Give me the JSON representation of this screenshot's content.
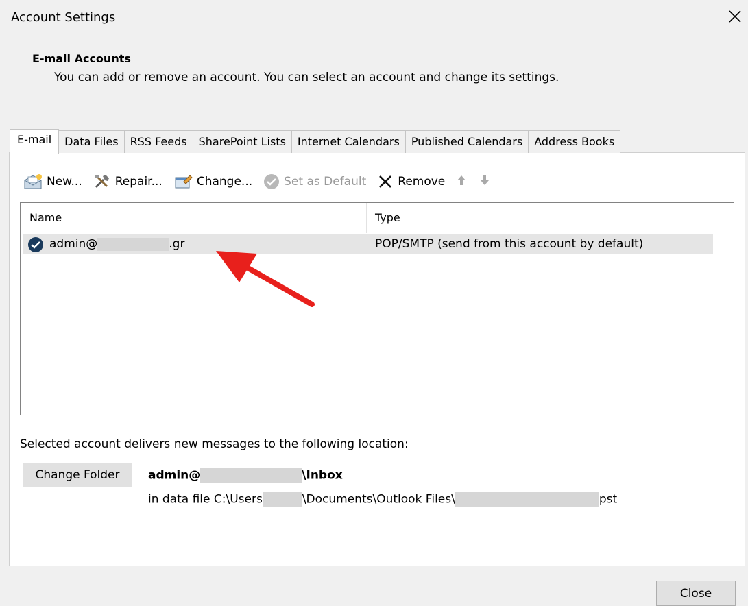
{
  "window": {
    "title": "Account Settings"
  },
  "section": {
    "title": "E-mail Accounts",
    "description": "You can add or remove an account. You can select an account and change its settings."
  },
  "tabs": [
    {
      "label": "E-mail",
      "active": true
    },
    {
      "label": "Data Files",
      "active": false
    },
    {
      "label": "RSS Feeds",
      "active": false
    },
    {
      "label": "SharePoint Lists",
      "active": false
    },
    {
      "label": "Internet Calendars",
      "active": false
    },
    {
      "label": "Published Calendars",
      "active": false
    },
    {
      "label": "Address Books",
      "active": false
    }
  ],
  "toolbar": {
    "new_label": "New...",
    "repair_label": "Repair...",
    "change_label": "Change...",
    "default_label": "Set as Default",
    "remove_label": "Remove"
  },
  "list": {
    "col_name": "Name",
    "col_type": "Type",
    "rows": [
      {
        "name_prefix": "admin@",
        "name_suffix": ".gr",
        "type": "POP/SMTP (send from this account by default)"
      }
    ]
  },
  "delivery": {
    "label": "Selected account delivers new messages to the following location:",
    "change_folder_label": "Change Folder",
    "folder_prefix": "admin@",
    "folder_suffix": "\\Inbox",
    "datafile_prefix": "in data file C:\\Users",
    "datafile_middle": "\\Documents\\Outlook Files\\",
    "datafile_suffix": "pst"
  },
  "footer": {
    "close_label": "Close"
  },
  "colors": {
    "annotation_arrow": "#e8201c",
    "default_badge": "#1a3a5c"
  }
}
